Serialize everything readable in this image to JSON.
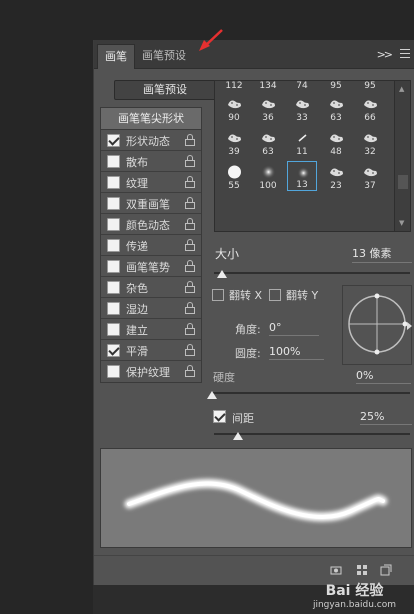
{
  "tabs": [
    {
      "label": "画笔",
      "active": true
    },
    {
      "label": "画笔预设",
      "active": false
    }
  ],
  "panel_menu": {
    "collapse_glyph": ">>"
  },
  "preset_button": {
    "label": "画笔预设"
  },
  "brush_options": {
    "header": "画笔笔尖形状",
    "items": [
      {
        "label": "形状动态",
        "checked": true
      },
      {
        "label": "散布",
        "checked": false
      },
      {
        "label": "纹理",
        "checked": false
      },
      {
        "label": "双重画笔",
        "checked": false
      },
      {
        "label": "颜色动态",
        "checked": false
      },
      {
        "label": "传递",
        "checked": false
      },
      {
        "label": "画笔笔势",
        "checked": false
      },
      {
        "label": "杂色",
        "checked": false
      },
      {
        "label": "湿边",
        "checked": false
      },
      {
        "label": "建立",
        "checked": false
      },
      {
        "label": "平滑",
        "checked": true
      },
      {
        "label": "保护纹理",
        "checked": false
      }
    ]
  },
  "brush_tips": {
    "top_row_sizes": [
      "112",
      "134",
      "74",
      "95",
      "95"
    ],
    "rows": [
      [
        "90",
        "36",
        "33",
        "63",
        "66"
      ],
      [
        "39",
        "63",
        "11",
        "48",
        "32"
      ],
      [
        "55",
        "100",
        "13",
        "23",
        "37"
      ]
    ],
    "selected": "13"
  },
  "size": {
    "label": "大小",
    "value": "13 像素",
    "fraction": 0.04
  },
  "flip_x": {
    "label": "翻转 X",
    "checked": false
  },
  "flip_y": {
    "label": "翻转 Y",
    "checked": false
  },
  "angle": {
    "label": "角度:",
    "value": "0°"
  },
  "roundness": {
    "label": "圆度:",
    "value": "100%"
  },
  "hardness": {
    "label": "硬度",
    "value": "0%",
    "fraction": 0.0
  },
  "spacing": {
    "label": "间距",
    "value": "25%",
    "checked": true,
    "fraction": 0.12
  },
  "watermark": {
    "logo": "Bai 经验",
    "url": "jingyan.baidu.com"
  },
  "colors": {
    "panel": "#535353",
    "background": "#262626",
    "selection": "#52a6dc",
    "annotation_arrow": "#e53030"
  }
}
